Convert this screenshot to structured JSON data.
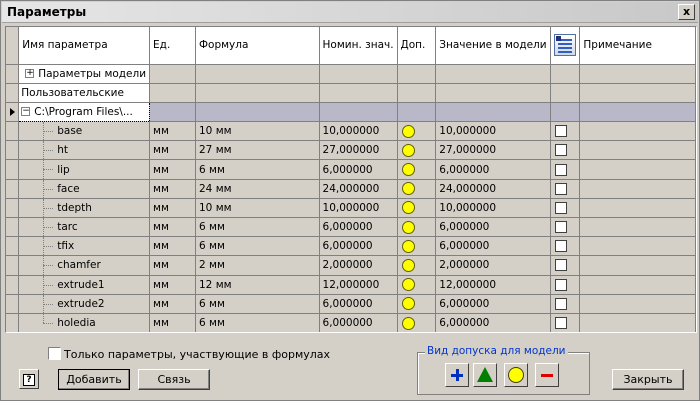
{
  "window": {
    "title": "Параметры",
    "close_label": "x"
  },
  "columns": [
    "Имя параметра",
    "Ед.",
    "Формула",
    "Номин. знач.",
    "Доп.",
    "Значение в модели",
    "",
    "Примечание"
  ],
  "groups": [
    {
      "expander": "+",
      "label": "Параметры модели"
    },
    {
      "expander": "",
      "label": "Пользовательские"
    },
    {
      "expander": "−",
      "label": "C:\\Program Files\\..."
    }
  ],
  "rows": [
    {
      "name": "base",
      "unit": "мм",
      "formula": "10 мм",
      "nominal": "10,000000",
      "model_value": "10,000000"
    },
    {
      "name": "ht",
      "unit": "мм",
      "formula": "27 мм",
      "nominal": "27,000000",
      "model_value": "27,000000"
    },
    {
      "name": "lip",
      "unit": "мм",
      "formula": "6 мм",
      "nominal": "6,000000",
      "model_value": "6,000000"
    },
    {
      "name": "face",
      "unit": "мм",
      "formula": "24 мм",
      "nominal": "24,000000",
      "model_value": "24,000000"
    },
    {
      "name": "tdepth",
      "unit": "мм",
      "formula": "10 мм",
      "nominal": "10,000000",
      "model_value": "10,000000"
    },
    {
      "name": "tarc",
      "unit": "мм",
      "formula": "6 мм",
      "nominal": "6,000000",
      "model_value": "6,000000"
    },
    {
      "name": "tfix",
      "unit": "мм",
      "formula": "6 мм",
      "nominal": "6,000000",
      "model_value": "6,000000"
    },
    {
      "name": "chamfer",
      "unit": "мм",
      "formula": "2 мм",
      "nominal": "2,000000",
      "model_value": "2,000000"
    },
    {
      "name": "extrude1",
      "unit": "мм",
      "formula": "12 мм",
      "nominal": "12,000000",
      "model_value": "12,000000"
    },
    {
      "name": "extrude2",
      "unit": "мм",
      "formula": "6 мм",
      "nominal": "6,000000",
      "model_value": "6,000000"
    },
    {
      "name": "holedia",
      "unit": "мм",
      "formula": "6 мм",
      "nominal": "6,000000",
      "model_value": "6,000000"
    }
  ],
  "filter": {
    "label": "Только параметры, участвующие в формулах"
  },
  "buttons": {
    "help": "?",
    "add": "Добавить",
    "link": "Связь",
    "close": "Закрыть"
  },
  "tolerance": {
    "legend": "Вид допуска для модели"
  },
  "colors": {
    "tolerance_dot": "#ffff00",
    "plus": "#0030c0",
    "triangle": "#008000",
    "minus": "#e00000"
  }
}
